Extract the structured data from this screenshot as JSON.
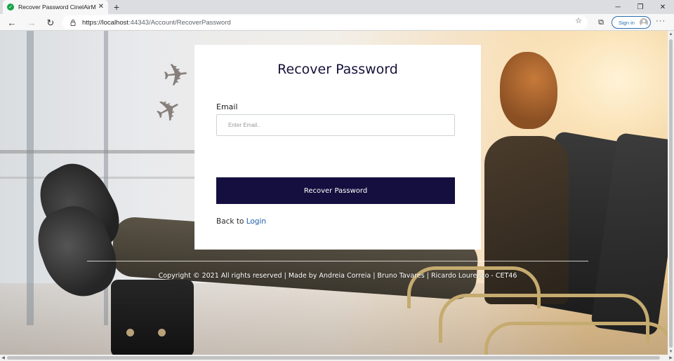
{
  "browser": {
    "tab": {
      "title": "Recover Password CinelAirMiles",
      "favicon": "check-circle-icon",
      "close": "✕"
    },
    "new_tab": "+",
    "window_controls": {
      "minimize": "─",
      "restore": "❐",
      "close": "✕"
    },
    "nav": {
      "back": "←",
      "forward": "→",
      "reload": "↻"
    },
    "address": {
      "prefix": "https://",
      "host": "localhost",
      "path": ":44343/Account/RecoverPassword"
    },
    "favorites_icon": "star-plus-icon",
    "collections_icon": "collections-icon",
    "sign_in_label": "Sign in",
    "menu_label": "···"
  },
  "page": {
    "card": {
      "title": "Recover Password",
      "email_label": "Email",
      "email_value": "",
      "email_placeholder": "Enter Email..",
      "submit_label": "Recover Password",
      "back_text": "Back to ",
      "login_link": "Login"
    },
    "footer": {
      "text": "Copyright © 2021 All rights reserved | Made by Andreia Correia | Bruno Tavares | Ricardo Lourenço - CET46"
    }
  },
  "colors": {
    "accent_dark": "#140f3e",
    "link": "#1f5fa8",
    "success_favicon": "#17a34a"
  }
}
